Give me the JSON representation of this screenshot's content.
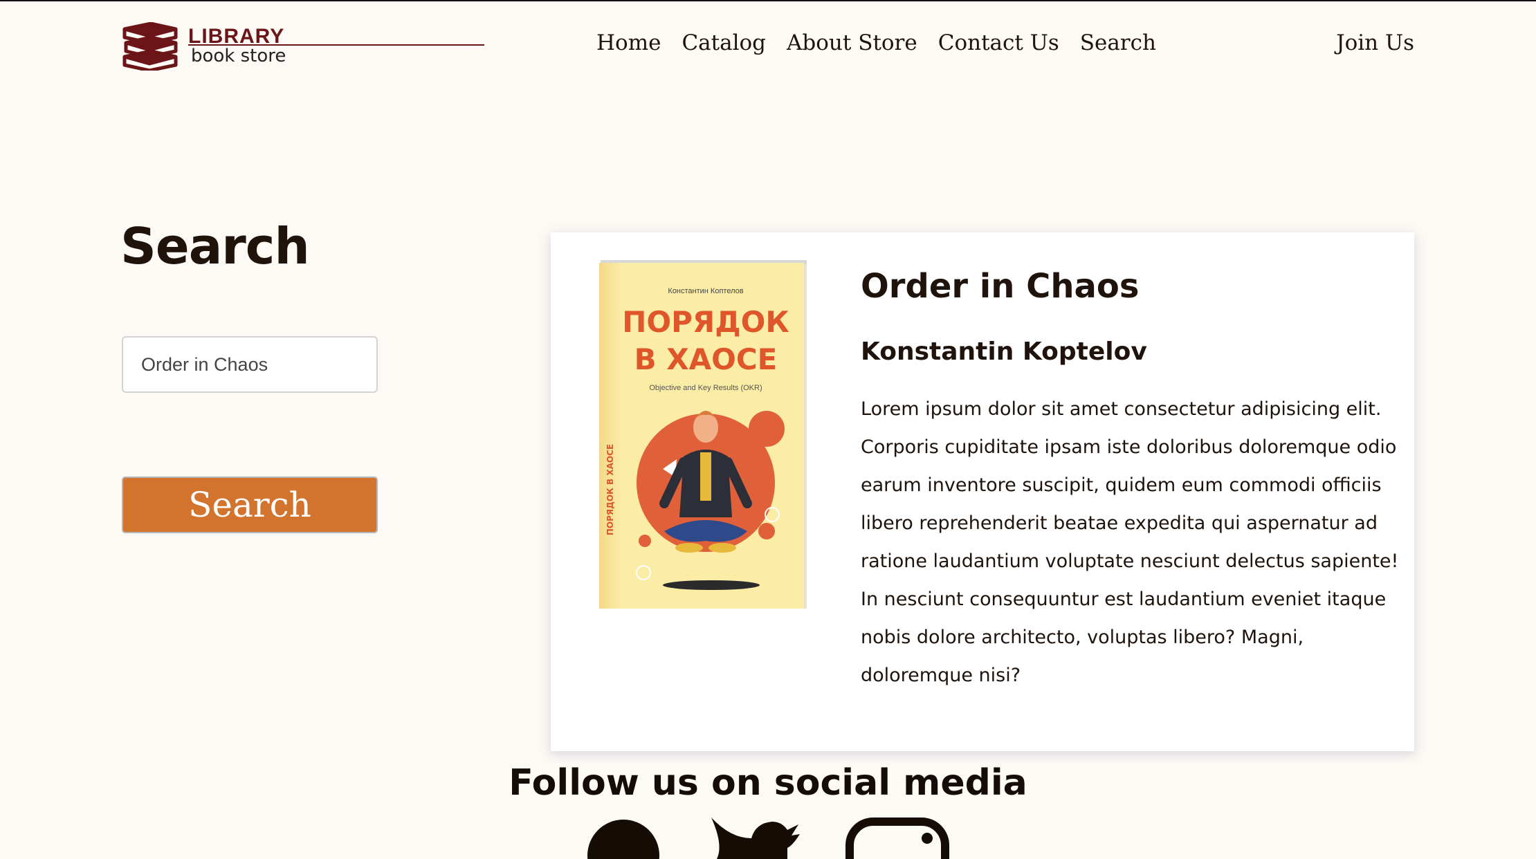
{
  "header": {
    "logo_title": "LIBRARY",
    "logo_subtitle": "book store",
    "nav": [
      "Home",
      "Catalog",
      "About Store",
      "Contact Us",
      "Search"
    ],
    "join": "Join Us"
  },
  "search": {
    "title": "Search",
    "input_value": "Order in Chaos",
    "button_label": "Search"
  },
  "result": {
    "title": "Order in Chaos",
    "author": "Konstantin Koptelov",
    "description": "Lorem ipsum dolor sit amet consectetur adipisicing elit. Corporis cupiditate ipsam iste doloribus doloremque odio earum inventore suscipit, quidem eum commodi officiis libero reprehenderit beatae expedita qui aspernatur ad ratione laudantium voluptate nesciunt delectus sapiente! In nesciunt consequuntur est laudantium eveniet itaque nobis dolore architecto, voluptas libero? Magni, doloremque nisi?",
    "cover": {
      "author_line": "Константин Коптелов",
      "title_line1": "ПОРЯДОК",
      "title_line2": "В ХАОСЕ",
      "subtitle": "Objective and Key Results (OKR)",
      "spine": "ПОРЯДОК В ХАОСЕ"
    }
  },
  "footer": {
    "follow": "Follow us on social media",
    "icons": [
      "facebook-icon",
      "twitter-icon",
      "instagram-icon"
    ]
  },
  "colors": {
    "background": "#fdf9f4",
    "brand": "#6b1518",
    "button": "#d2742e",
    "text": "#1f130c"
  }
}
